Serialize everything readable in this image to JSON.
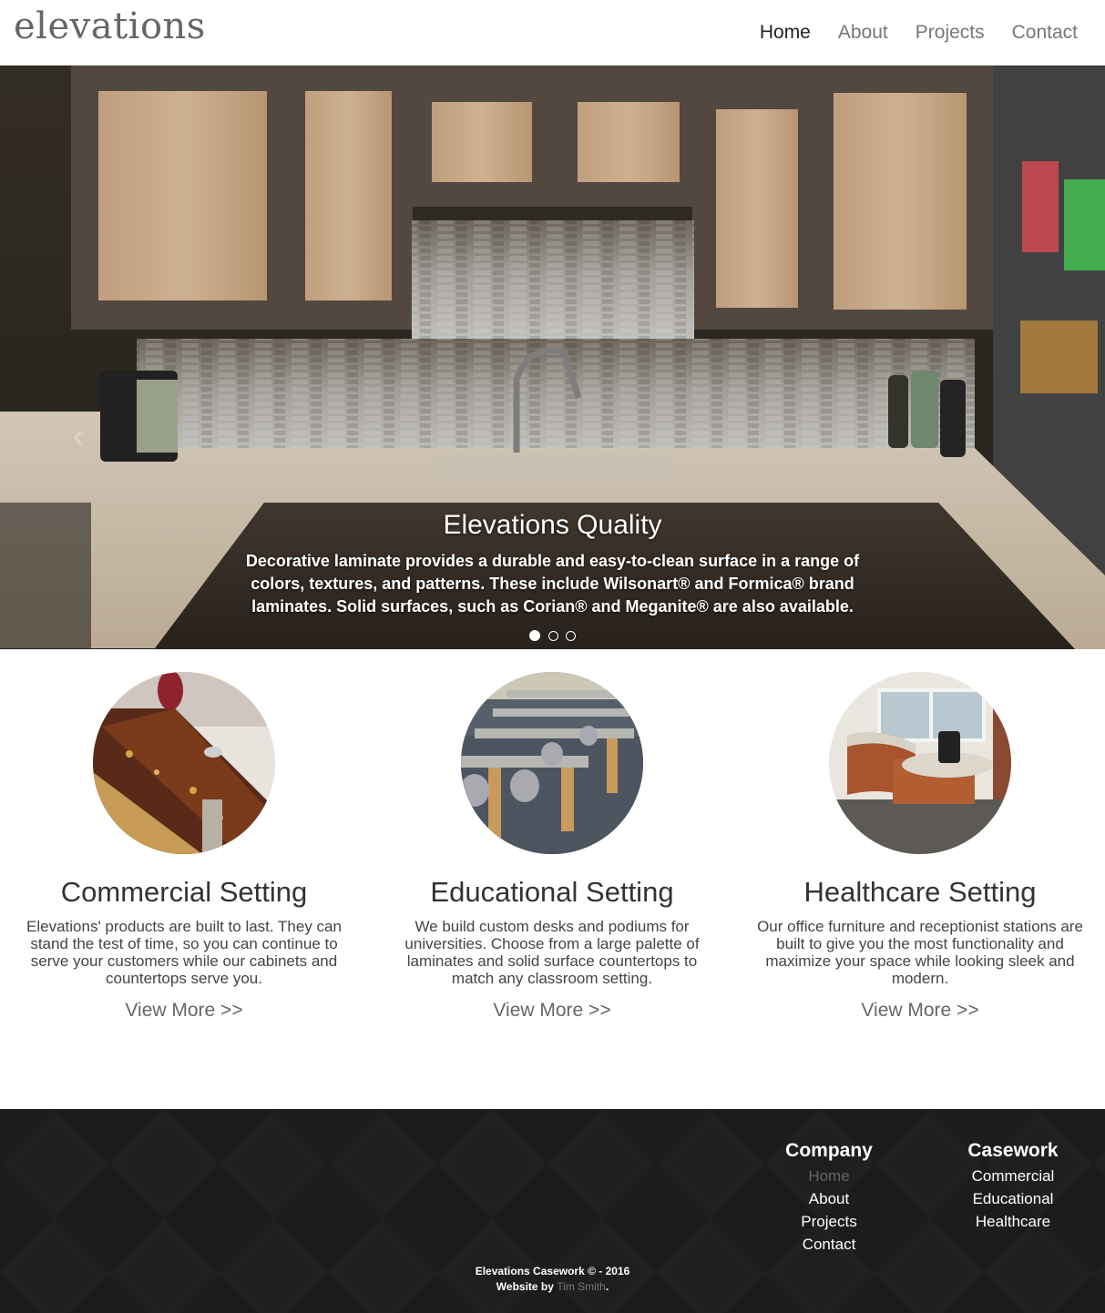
{
  "brand": {
    "logo": "elevations"
  },
  "nav": {
    "items": [
      {
        "label": "Home",
        "active": true
      },
      {
        "label": "About"
      },
      {
        "label": "Projects"
      },
      {
        "label": "Contact"
      }
    ]
  },
  "hero": {
    "title": "Elevations Quality",
    "text": "Decorative laminate provides a durable and easy-to-clean surface in a range of colors, textures, and patterns. These include Wilsonart® and Formica® brand laminates. Solid surfaces, such as Corian® and Meganite® are also available.",
    "prev_icon": "‹",
    "slides": 3,
    "active_slide": 1
  },
  "features": [
    {
      "title": "Commercial Setting",
      "text": "Elevations' products are built to last. They can stand the test of time, so you can continue to serve your customers while our cabinets and countertops serve you.",
      "link": "View More >>"
    },
    {
      "title": "Educational Setting",
      "text": "We build custom desks and podiums for universities. Choose from a large palette of laminates and solid surface countertops to match any classroom setting.",
      "link": "View More >>"
    },
    {
      "title": "Healthcare Setting",
      "text": "Our office furniture and receptionist stations are built to give you the most functionality and maximize your space while looking sleek and modern.",
      "link": "View More >>"
    }
  ],
  "footer": {
    "company": {
      "heading": "Company",
      "links": [
        "Home",
        "About",
        "Projects",
        "Contact"
      ]
    },
    "casework": {
      "heading": "Casework",
      "links": [
        "Commercial",
        "Educational",
        "Healthcare"
      ]
    },
    "copyright": "Elevations Casework © - 2016",
    "credit_prefix": "Website by",
    "credit_name": "Tim Smith",
    "credit_suffix": "."
  },
  "colors": {
    "footer_bg": "#1c1c1c",
    "nav_active": "#222222",
    "nav_inactive": "#777777"
  }
}
